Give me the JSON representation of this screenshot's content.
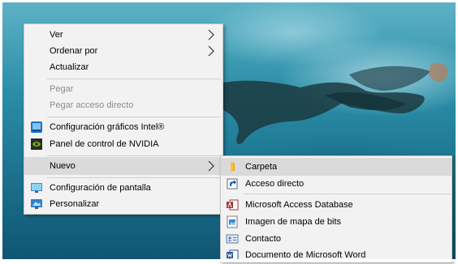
{
  "context_menu": {
    "items": [
      {
        "label": "Ver"
      },
      {
        "label": "Ordenar por"
      },
      {
        "label": "Actualizar"
      },
      {
        "label": "Pegar"
      },
      {
        "label": "Pegar acceso directo"
      },
      {
        "label": "Configuración gráficos Intel®",
        "icon": "intel-graphics-icon"
      },
      {
        "label": "Panel de control de NVIDIA",
        "icon": "nvidia-icon"
      },
      {
        "label": "Nuevo"
      },
      {
        "label": "Configuración de pantalla",
        "icon": "display-settings-icon"
      },
      {
        "label": "Personalizar",
        "icon": "personalize-icon"
      }
    ]
  },
  "submenu_nuevo": {
    "items": [
      {
        "label": "Carpeta",
        "icon": "folder-icon"
      },
      {
        "label": "Acceso directo",
        "icon": "shortcut-icon"
      },
      {
        "label": "Microsoft Access Database",
        "icon": "access-icon"
      },
      {
        "label": "Imagen de mapa de bits",
        "icon": "bitmap-icon"
      },
      {
        "label": "Contacto",
        "icon": "contact-icon"
      },
      {
        "label": "Documento de Microsoft Word",
        "icon": "word-icon"
      }
    ]
  },
  "colors": {
    "menu_bg": "#f2f2f2",
    "highlight": "#dadada",
    "disabled_text": "#8d8d8d"
  }
}
